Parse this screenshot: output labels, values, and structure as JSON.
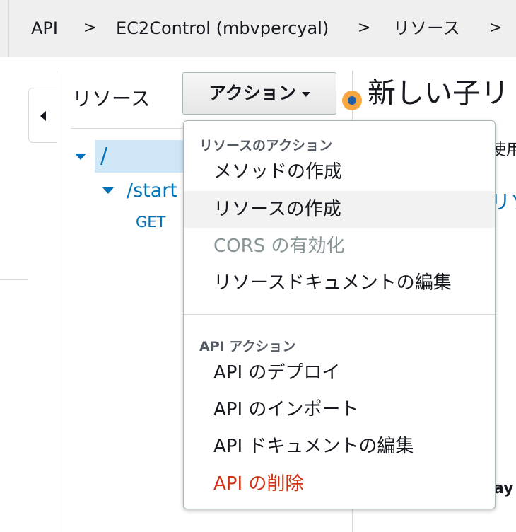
{
  "breadcrumb": {
    "items": [
      "API",
      "EC2Control (mbvpercyal)",
      "リソース"
    ],
    "separator": ">"
  },
  "resources_panel": {
    "title": "リソース",
    "tree": {
      "root": "/",
      "child": "/start",
      "method": "GET"
    }
  },
  "actions_button": {
    "label": "アクション"
  },
  "right_panel": {
    "heading_partial": "新しい子リ",
    "fragment_use": "使用",
    "fragment_link": "リソ",
    "fragment_bold": "ay"
  },
  "menu": {
    "resource_group_title": "リソースのアクション",
    "resource_items": [
      {
        "label": "メソッドの作成",
        "state": "normal"
      },
      {
        "label": "リソースの作成",
        "state": "hover"
      },
      {
        "label": "CORS の有効化",
        "state": "disabled"
      },
      {
        "label": "リソースドキュメントの編集",
        "state": "normal"
      }
    ],
    "api_group_title": "API アクション",
    "api_items": [
      {
        "label": "API のデプロイ",
        "state": "normal"
      },
      {
        "label": "API のインポート",
        "state": "normal"
      },
      {
        "label": "API ドキュメントの編集",
        "state": "normal"
      },
      {
        "label": "API の削除",
        "state": "danger"
      }
    ]
  },
  "colors": {
    "link": "#0073bb",
    "danger": "#d13212",
    "disabled": "#879596",
    "selection": "#cfe6f7",
    "hint_dot": "#f7a640"
  }
}
